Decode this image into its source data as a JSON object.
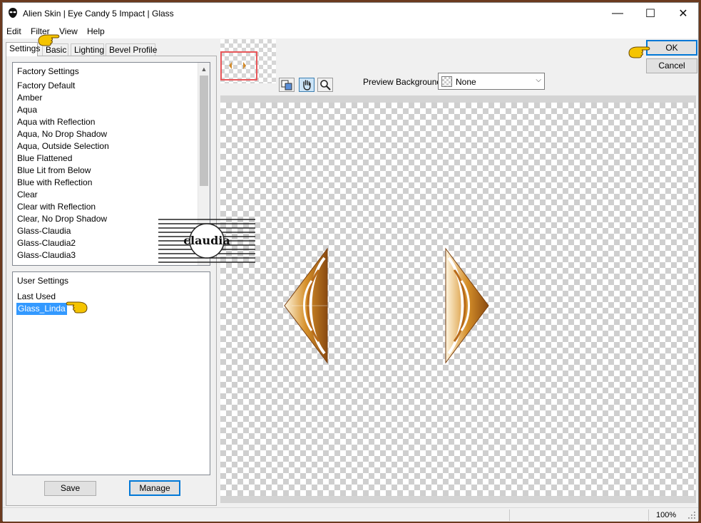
{
  "window": {
    "title": "Alien Skin | Eye Candy 5 Impact | Glass",
    "controls": {
      "minimize": "—",
      "maximize": "☐",
      "close": "✕"
    }
  },
  "menu": [
    "Edit",
    "Filter",
    "View",
    "Help"
  ],
  "tabs": [
    "Settings",
    "Basic",
    "Lighting",
    "Bevel Profile"
  ],
  "active_tab": "Settings",
  "factory_settings": {
    "header": "Factory Settings",
    "items": [
      "Factory Default",
      "Amber",
      "Aqua",
      "Aqua with Reflection",
      "Aqua, No Drop Shadow",
      "Aqua, Outside Selection",
      "Blue Flattened",
      "Blue Lit from Below",
      "Blue with Reflection",
      "Clear",
      "Clear with Reflection",
      "Clear, No Drop Shadow",
      "Glass-Claudia",
      "Glass-Claudia2",
      "Glass-Claudia3"
    ]
  },
  "user_settings": {
    "header": "User Settings",
    "items": [
      "Last Used",
      "Glass_Linda"
    ],
    "selected": "Glass_Linda"
  },
  "buttons": {
    "save": "Save",
    "manage": "Manage",
    "ok": "OK",
    "cancel": "Cancel"
  },
  "preview_background": {
    "label": "Preview Background:",
    "value": "None"
  },
  "status": {
    "zoom": "100%"
  },
  "watermark": {
    "text": "claudia"
  },
  "colors": {
    "selection": "#3399ff",
    "accent": "#0078d7",
    "pointer": "#f5c400",
    "frame": "#e8575a"
  }
}
